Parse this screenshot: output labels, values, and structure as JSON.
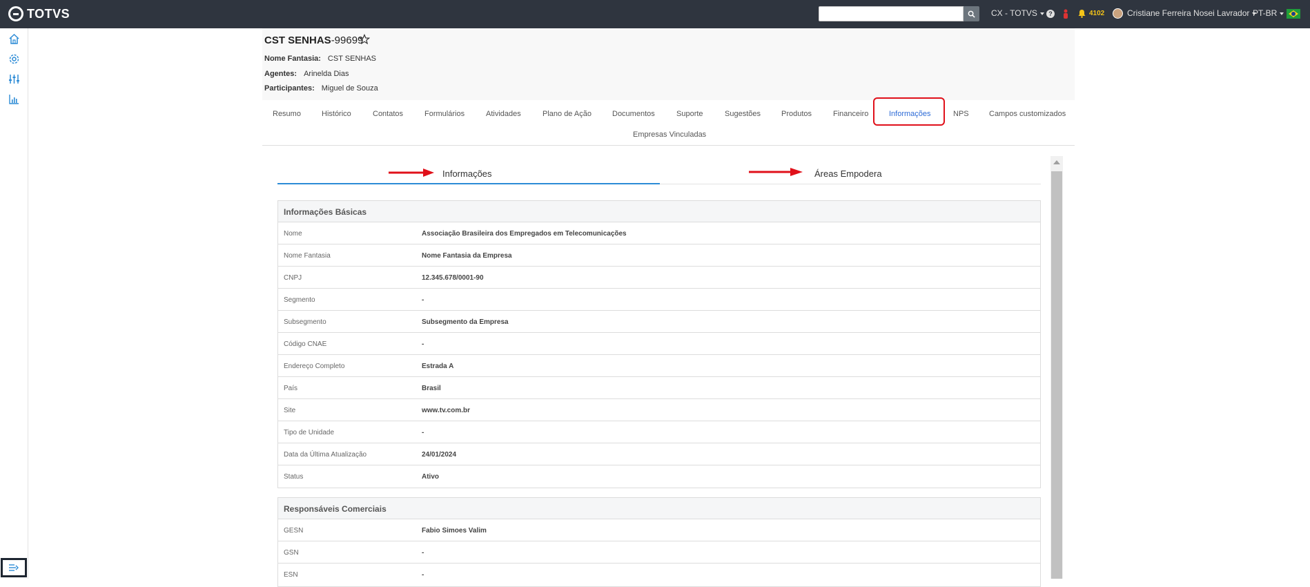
{
  "topbar": {
    "brand": "TOTVS",
    "search_placeholder": "",
    "org_selector": "CX - TOTVS",
    "notif_count": "4102",
    "user_name": "Cristiane Ferreira Nosei Lavrador",
    "language": "PT-BR"
  },
  "company": {
    "name": "CST SENHAS",
    "id_suffix": "-99699",
    "nome_fantasia_label": "Nome Fantasia:",
    "nome_fantasia_value": "CST SENHAS",
    "agentes_label": "Agentes:",
    "agentes_value": "Arinelda Dias",
    "participantes_label": "Participantes:",
    "participantes_value": "Miguel de Souza"
  },
  "tabs": [
    "Resumo",
    "Histórico",
    "Contatos",
    "Formulários",
    "Atividades",
    "Plano de Ação",
    "Documentos",
    "Suporte",
    "Sugestões",
    "Produtos",
    "Financeiro",
    "Informações",
    "NPS",
    "Campos customizados",
    "Empresas Vinculadas"
  ],
  "subtabs": [
    "Informações",
    "Áreas Empodera"
  ],
  "basic_info": {
    "title": "Informações Básicas",
    "rows": [
      {
        "k": "Nome",
        "v": "Associação Brasileira dos Empregados em Telecomunicações"
      },
      {
        "k": "Nome Fantasia",
        "v": "Nome Fantasia da Empresa"
      },
      {
        "k": "CNPJ",
        "v": "12.345.678/0001-90"
      },
      {
        "k": "Segmento",
        "v": "-"
      },
      {
        "k": "Subsegmento",
        "v": "Subsegmento da Empresa"
      },
      {
        "k": "Código CNAE",
        "v": "-"
      },
      {
        "k": "Endereço Completo",
        "v": "Estrada A"
      },
      {
        "k": "País",
        "v": "Brasil"
      },
      {
        "k": "Site",
        "v": "www.tv.com.br"
      },
      {
        "k": "Tipo de Unidade",
        "v": "-"
      },
      {
        "k": "Data da Última Atualização",
        "v": "24/01/2024"
      },
      {
        "k": "Status",
        "v": "Ativo"
      }
    ]
  },
  "commercial": {
    "title": "Responsáveis Comerciais",
    "rows": [
      {
        "k": "GESN",
        "v": "Fabio Simoes Valim"
      },
      {
        "k": "GSN",
        "v": "-"
      },
      {
        "k": "ESN",
        "v": "-"
      }
    ]
  },
  "colors": {
    "topbar": "#2f353f",
    "accent": "#2c6ad6",
    "highlight": "#e0101a"
  }
}
